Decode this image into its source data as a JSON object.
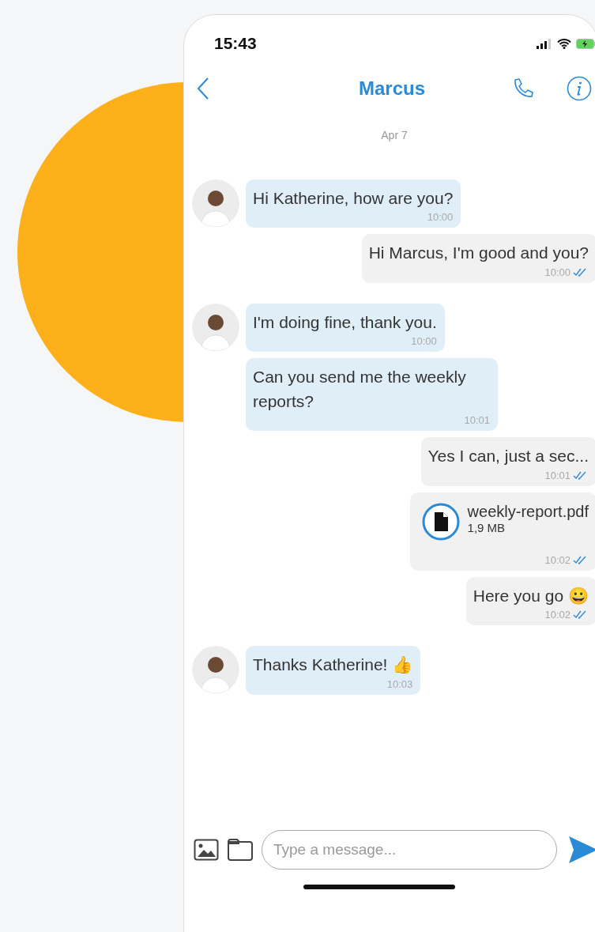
{
  "status_bar": {
    "time": "15:43"
  },
  "header": {
    "title": "Marcus"
  },
  "date_label": "Apr 7",
  "messages": [
    {
      "kind": "incoming",
      "avatar": true,
      "text": "Hi Katherine, how are you?",
      "time": "10:00"
    },
    {
      "kind": "outgoing",
      "read": true,
      "text": "Hi Marcus, I'm good and you?",
      "time": "10:00"
    },
    {
      "kind": "incoming",
      "avatar": true,
      "text": "I'm doing fine, thank you.",
      "time": "10:00"
    },
    {
      "kind": "incoming",
      "avatar": false,
      "text": "Can you send me the weekly reports?",
      "time": "10:01"
    },
    {
      "kind": "outgoing",
      "read": true,
      "text": "Yes I can, just a sec...",
      "time": "10:01"
    },
    {
      "kind": "outgoing_file",
      "read": true,
      "file_name": "weekly-report.pdf",
      "file_size": "1,9 MB",
      "time": "10:02"
    },
    {
      "kind": "outgoing",
      "read": true,
      "text": "Here you go 😀",
      "time": "10:02"
    },
    {
      "kind": "incoming",
      "avatar": true,
      "text": "Thanks Katherine! 👍",
      "time": "10:03"
    }
  ],
  "composer": {
    "placeholder": "Type a message..."
  }
}
